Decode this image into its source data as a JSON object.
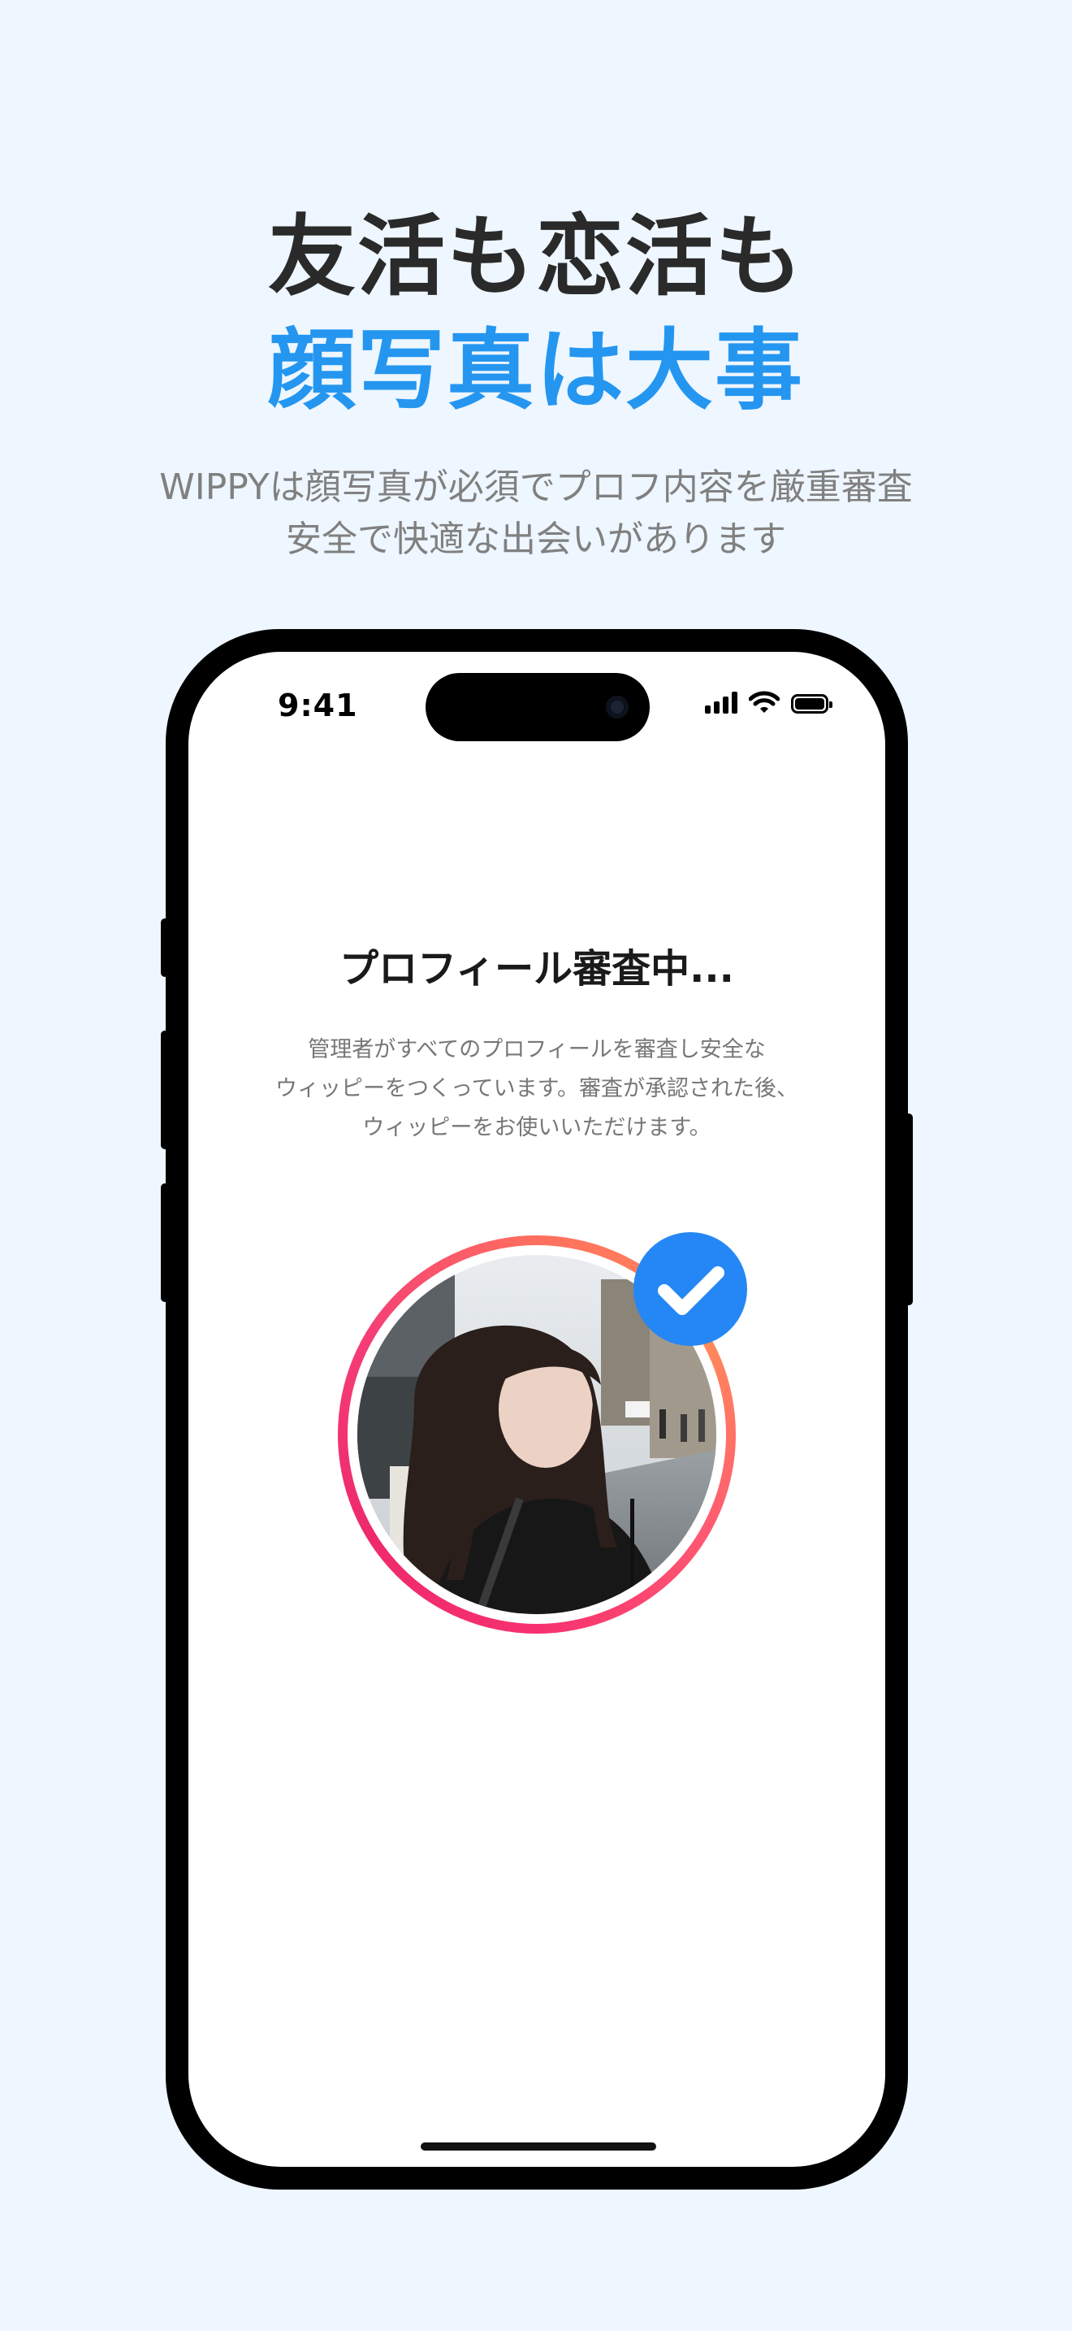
{
  "promo": {
    "headline_line1": "友活も恋活も",
    "headline_line2": "顔写真は大事",
    "subtitle_line1": "WIPPYは顔写真が必須でプロフ内容を厳重審査",
    "subtitle_line2": "安全で快適な出会いがあります"
  },
  "status_bar": {
    "time": "9:41",
    "icons": [
      "cellular-signal-icon",
      "wifi-icon",
      "battery-icon"
    ]
  },
  "review": {
    "title": "プロフィール審査中...",
    "description_lines": [
      "管理者がすべてのプロフィールを審査し安全な",
      "ウィッピーをつくっています。審査が承認された後、",
      "ウィッピーをお使いいただけます。"
    ]
  },
  "colors": {
    "background": "#eef6ff",
    "headline_dark": "#2a2a2a",
    "headline_accent": "#2496f0",
    "badge_blue": "#2587f5",
    "ring_gradient": [
      "#ff8a5a",
      "#f7306f"
    ]
  }
}
